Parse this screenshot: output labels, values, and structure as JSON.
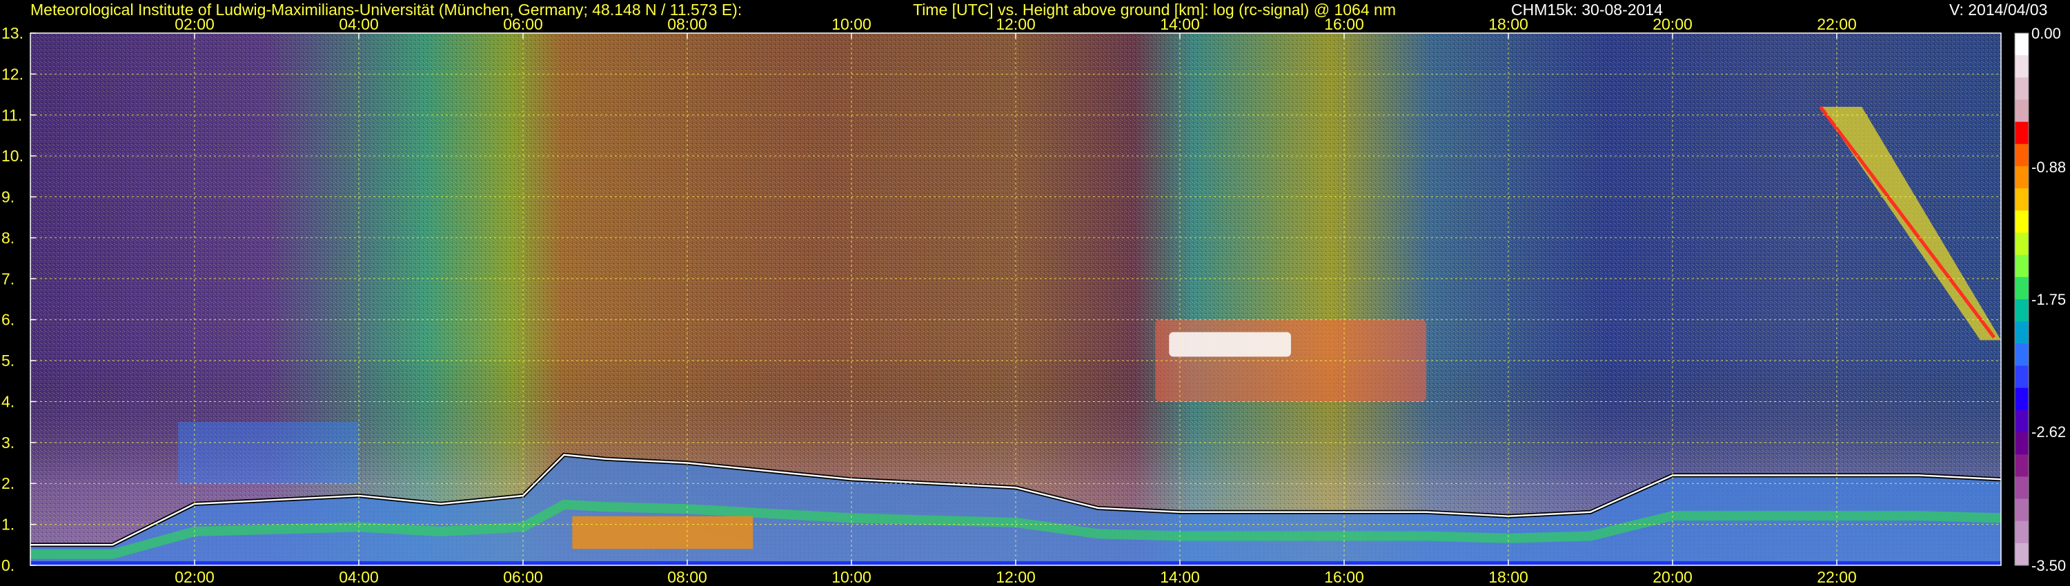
{
  "header": {
    "institute": "Meteorological Institute of Ludwig-Maximilians-Universität (München, Germany; 48.148 N / 11.573 E):",
    "description": "Time [UTC] vs. Height above ground [km]: log (rc-signal) @ 1064 nm",
    "instrument_date": "CHM15k: 30-08-2014",
    "version": "V: 2014/04/03"
  },
  "chart_data": {
    "type": "heatmap",
    "x_label": "Time [UTC]",
    "y_label": "Height above ground [km]",
    "quantity": "log (rc-signal) @ 1064 nm",
    "xlim": [
      0,
      24
    ],
    "ylim": [
      0,
      13
    ],
    "x_ticks": [
      2,
      4,
      6,
      8,
      10,
      12,
      14,
      16,
      18,
      20,
      22
    ],
    "x_tick_labels": [
      "02:00",
      "04:00",
      "06:00",
      "08:00",
      "10:00",
      "12:00",
      "14:00",
      "16:00",
      "18:00",
      "20:00",
      "22:00"
    ],
    "y_ticks": [
      0,
      1,
      2,
      3,
      4,
      5,
      6,
      7,
      8,
      9,
      10,
      11,
      12,
      13
    ],
    "y_tick_labels": [
      "0.",
      "1.",
      "2.",
      "3.",
      "4.",
      "5.",
      "6.",
      "7.",
      "8.",
      "9.",
      "10.",
      "11.",
      "12.",
      "13."
    ],
    "grid": true,
    "colorbar": {
      "position": "right",
      "range": [
        -3.5,
        0.0
      ],
      "tick_values": [
        0.0,
        -0.88,
        -1.75,
        -2.62,
        -3.5
      ],
      "tick_labels": [
        "0.00",
        "-0.88",
        "-1.75",
        "-2.62",
        "-3.50"
      ],
      "colors": [
        "#ffffff",
        "#f0e0e8",
        "#e0c0cc",
        "#d8aab8",
        "#ff0000",
        "#ff6000",
        "#ff9000",
        "#ffc000",
        "#ffff00",
        "#c0ff20",
        "#80ff40",
        "#30e060",
        "#00c0a0",
        "#00a0d0",
        "#3070ff",
        "#3040ff",
        "#2000ff",
        "#5000c0",
        "#6a0090",
        "#8a1a8a",
        "#a04aa0",
        "#b070b0",
        "#c090c0",
        "#d0b0d0"
      ]
    },
    "boundary_layer_top_km": [
      [
        0.0,
        0.5
      ],
      [
        1.0,
        0.5
      ],
      [
        2.0,
        1.5
      ],
      [
        3.0,
        1.6
      ],
      [
        4.0,
        1.7
      ],
      [
        5.0,
        1.5
      ],
      [
        6.0,
        1.7
      ],
      [
        6.5,
        2.7
      ],
      [
        7.0,
        2.6
      ],
      [
        8.0,
        2.5
      ],
      [
        9.0,
        2.3
      ],
      [
        10.0,
        2.1
      ],
      [
        11.0,
        2.0
      ],
      [
        12.0,
        1.9
      ],
      [
        13.0,
        1.4
      ],
      [
        14.0,
        1.3
      ],
      [
        15.0,
        1.3
      ],
      [
        16.0,
        1.3
      ],
      [
        17.0,
        1.3
      ],
      [
        18.0,
        1.2
      ],
      [
        19.0,
        1.3
      ],
      [
        20.0,
        2.2
      ],
      [
        21.0,
        2.2
      ],
      [
        22.0,
        2.2
      ],
      [
        23.0,
        2.2
      ],
      [
        24.0,
        2.1
      ]
    ],
    "features": [
      {
        "type": "cloud",
        "t_start": 13.7,
        "t_end": 17.0,
        "h_min": 4.0,
        "h_max": 6.0
      },
      {
        "type": "cirrus",
        "t_start": 21.8,
        "t_end": 24.0,
        "h_min": 5.5,
        "h_max": 11.2
      },
      {
        "type": "elevated_layer",
        "t_start": 1.8,
        "t_end": 4.0,
        "h_min": 2.0,
        "h_max": 3.5
      }
    ]
  }
}
